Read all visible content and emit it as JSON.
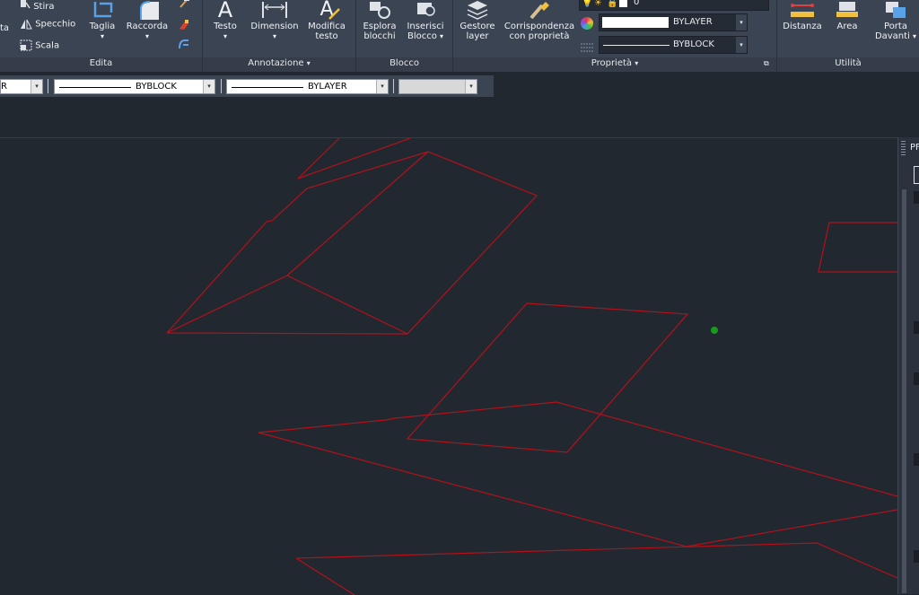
{
  "ribbon": {
    "panels": {
      "edita": "Edita",
      "annotazione": "Annotazione",
      "blocco": "Blocco",
      "proprieta": "Proprietà",
      "utilita": "Utilità"
    },
    "edita": {
      "partial_left": "ta",
      "stira": "Stira",
      "specchio": "Specchio",
      "scala": "Scala",
      "taglia": "Taglia",
      "raccorda": "Raccorda"
    },
    "annotazione": {
      "testo": "Testo",
      "dimension": "Dimension",
      "modifica_l1": "Modifica",
      "modifica_l2": "testo"
    },
    "blocco": {
      "esplora_l1": "Esplora",
      "esplora_l2": "blocchi",
      "inserisci_l1": "Inserisci",
      "inserisci_l2": "Blocco"
    },
    "proprieta": {
      "gestore_l1": "Gestore",
      "gestore_l2": "layer",
      "corr_l1": "Corrispondenza",
      "corr_l2": "con proprietà",
      "layer_name": "0",
      "color_value": "BYLAYER",
      "linetype_value": "BYBLOCK"
    },
    "utilita": {
      "distanza": "Distanza",
      "area": "Area",
      "porta_l1": "Porta",
      "porta_l2": "Davanti"
    }
  },
  "properties_bar": {
    "combo1_text": "R",
    "combo2_text": "BYBLOCK",
    "combo3_text": "BYLAYER",
    "combo4_text": ""
  },
  "right_panel": {
    "title_partial": "PF"
  },
  "colors": {
    "canvas_bg": "#212830",
    "drawing_line": "#b3111b",
    "cursor_point": "#1a9a1a",
    "ribbon_bg": "#3b4453"
  }
}
